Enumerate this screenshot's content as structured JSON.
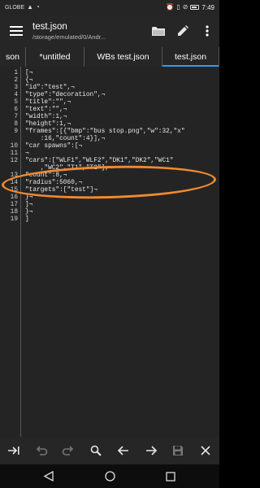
{
  "status": {
    "carrier": "GLOBE",
    "time": "7:49"
  },
  "app": {
    "title": "test.json",
    "subtitle": "/storage/emulated/0/Andr...",
    "menu_icon": "hamburger-menu-icon",
    "actions": [
      "folder-open-icon",
      "edit-pencil-icon",
      "overflow-menu-icon"
    ]
  },
  "tabs": [
    {
      "label": "son",
      "active": false
    },
    {
      "label": "*untitled",
      "active": false
    },
    {
      "label": "WBs test.json",
      "active": false
    },
    {
      "label": "test.json",
      "active": true
    }
  ],
  "editor": {
    "line_numbers": [
      "1",
      "2",
      "3",
      "4",
      "5",
      "6",
      "7",
      "8",
      "9",
      "10",
      "11",
      "12",
      "13",
      "14",
      "15",
      "16",
      "17",
      "18",
      "19"
    ],
    "lines": [
      "[¬",
      "{¬",
      "\"id\":\"test\",¬",
      "\"type\":\"decoration\",¬",
      "\"title\":\"\",¬",
      "\"text\":\"\",¬",
      "\"width\":1,¬",
      "\"height\":1,¬",
      "\"frames\":[{\"bmp\":\"bus stop.png\",\"w\":32,\"x\"",
      "\"car spawns\":[¬",
      "¬",
      "\"cars\":[\"WLF1\",\"WLF2\",\"DK1\",\"DK2\",\"WC1\"",
      "\"count\":8,¬",
      "\"radius\":5060,¬",
      "\"targets\":[\"test\"]¬",
      "}¬",
      "]¬",
      "}¬",
      "]"
    ],
    "wrapped": [
      "    :16,\"count\":4}],¬",
      "    ,\"WC2\",\"T1\",\"T2\"],¬"
    ]
  },
  "toolbar": {
    "icons": [
      "tab-indent-icon",
      "undo-icon",
      "redo-icon",
      "search-icon",
      "arrow-left-icon",
      "arrow-right-icon",
      "save-icon",
      "close-icon"
    ]
  },
  "colors": {
    "background": "#242424",
    "bar": "#262626",
    "tab_indicator": "#2a9df4",
    "annotation": "#f08a30"
  }
}
